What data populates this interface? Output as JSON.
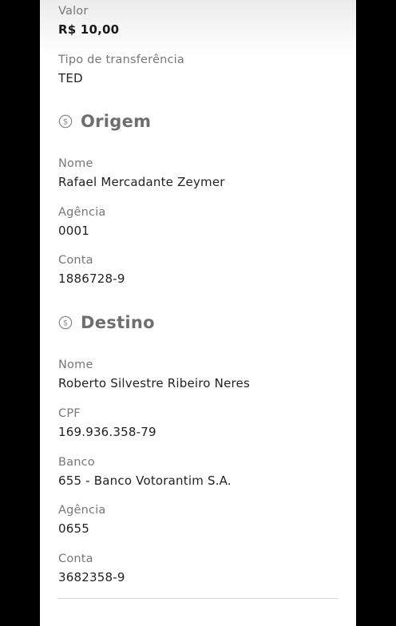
{
  "transfer": {
    "amount_label": "Valor",
    "amount_value": "R$ 10,00",
    "type_label": "Tipo de transferência",
    "type_value": "TED"
  },
  "origin": {
    "title": "Origem",
    "icon": "dollar-coin-icon",
    "name_label": "Nome",
    "name_value": "Rafael Mercadante Zeymer",
    "agency_label": "Agência",
    "agency_value": "0001",
    "account_label": "Conta",
    "account_value": "1886728-9"
  },
  "destination": {
    "title": "Destino",
    "icon": "dollar-coin-icon",
    "name_label": "Nome",
    "name_value": "Roberto Silvestre Ribeiro Neres",
    "cpf_label": "CPF",
    "cpf_value": "169.936.358-79",
    "bank_label": "Banco",
    "bank_value": "655 - Banco Votorantim S.A.",
    "agency_label": "Agência",
    "agency_value": "0655",
    "account_label": "Conta",
    "account_value": "3682358-9"
  },
  "colors": {
    "background": "#000000",
    "panel": "#ffffff",
    "label": "#777777",
    "value": "#222222",
    "section_title": "#6e6e6e"
  }
}
